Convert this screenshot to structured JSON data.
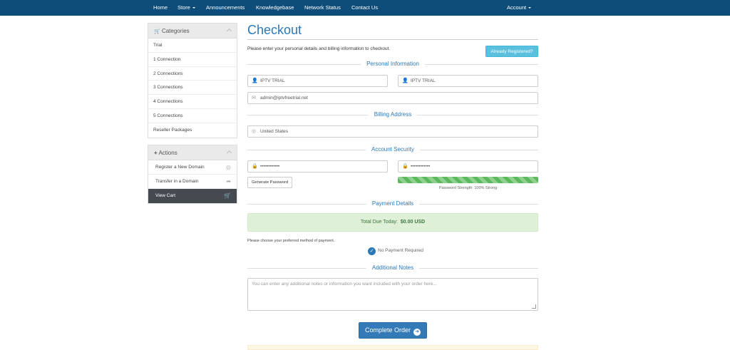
{
  "nav": {
    "home": "Home",
    "store": "Store",
    "announcements": "Announcements",
    "knowledgebase": "Knowledgebase",
    "network_status": "Network Status",
    "contact_us": "Contact Us",
    "account": "Account"
  },
  "sidebar": {
    "categories_title": "Categories",
    "categories": [
      "Trial",
      "1 Connection",
      "2 Connections",
      "3 Connections",
      "4 Connections",
      "5 Connections",
      "Reseller Packages"
    ],
    "actions_title": "Actions",
    "actions": [
      {
        "label": "Register a New Domain",
        "icon": "globe-icon"
      },
      {
        "label": "Transfer in a Domain",
        "icon": "share-icon"
      },
      {
        "label": "View Cart",
        "icon": "cart-icon"
      }
    ]
  },
  "main": {
    "title": "Checkout",
    "intro": "Please enter your personal details and billing information to checkout.",
    "already_registered": "Already Registered?",
    "personal_info_heading": "Personal Information",
    "first_name": "IPTV TRIAL",
    "last_name": "IPTV TRIAL",
    "email": "admin@iptvfreetrial.net",
    "billing_heading": "Billing Address",
    "country": "United States",
    "security_heading": "Account Security",
    "password": "••••••••••••",
    "password_confirm": "••••••••••••",
    "generate_password": "Generate Password",
    "strength_label": "Password Strength: 100% Strong",
    "strength_value": 1.0,
    "payment_heading": "Payment Details",
    "total_label": "Total Due Today:",
    "total_value": "$0.00 USD",
    "payment_hint": "Please choose your preferred method of payment.",
    "payment_option": "No Payment Required",
    "notes_heading": "Additional Notes",
    "notes_placeholder": "You can enter any additional notes or information you want included with your order here...",
    "complete_order": "Complete Order"
  },
  "colors": {
    "nav_bg": "#0e4d79",
    "accent": "#2a78b8",
    "info_button": "#5bc0de",
    "success_bg": "#dff0d8",
    "primary_button": "#337ab7"
  }
}
